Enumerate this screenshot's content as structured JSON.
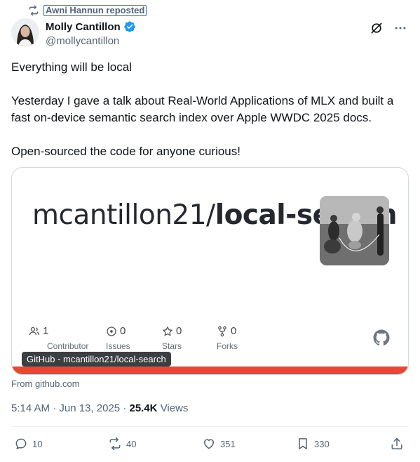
{
  "repost": {
    "text": "Awni Hannun reposted",
    "icon": "repost-icon"
  },
  "author": {
    "name": "Molly Cantillon",
    "handle": "@mollycantillon",
    "verified": true
  },
  "tweet": {
    "line1": "Everything will be local",
    "line2": "Yesterday I gave a talk about Real-World Applications of MLX and built a fast on-device semantic search index over Apple WWDC 2025 docs.",
    "line3": "Open-sourced the code for anyone curious!"
  },
  "card": {
    "title_regular": "mcantillon21/",
    "title_bold": "local-search",
    "stats": [
      {
        "value": "1",
        "label": "Contributor",
        "icon": "contributor-icon"
      },
      {
        "value": "0",
        "label": "Issues",
        "icon": "issues-icon"
      },
      {
        "value": "0",
        "label": "Stars",
        "icon": "star-icon"
      },
      {
        "value": "0",
        "label": "Forks",
        "icon": "fork-icon"
      }
    ],
    "badge": "GitHub - mcantillon21/local-search",
    "accent_color": "#e64833"
  },
  "from": "From github.com",
  "meta": {
    "time": "5:14 AM",
    "date": "Jun 13, 2025",
    "views_count": "25.4K",
    "views_label": "Views"
  },
  "actions": {
    "replies": "10",
    "reposts": "40",
    "likes": "351",
    "bookmarks": "330"
  },
  "colors": {
    "brand_blue": "#1d9bf0",
    "muted": "#536471"
  }
}
